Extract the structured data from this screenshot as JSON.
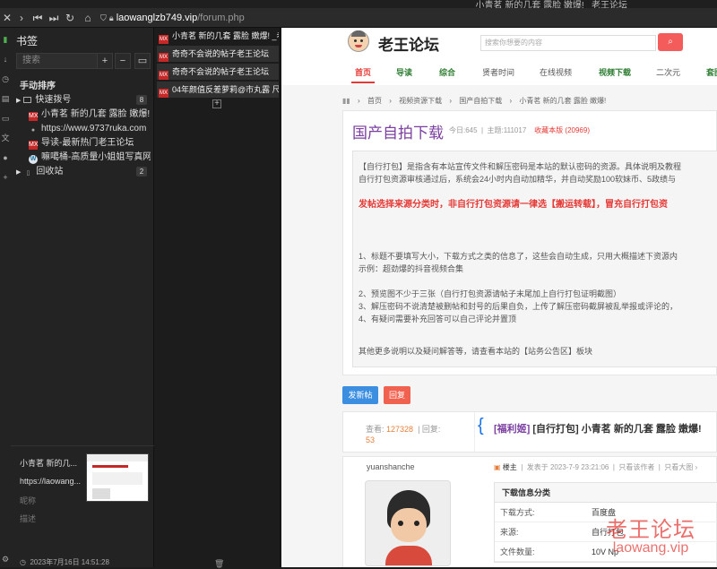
{
  "window": {
    "title": "小青茗 新的几套 露脸 嫩爆! _老王论坛"
  },
  "navbar": {
    "domain": "laowanglzb749.vip",
    "path": "/forum.php"
  },
  "bookmarks": {
    "heading": "书签",
    "search_placeholder": "搜索",
    "add_label": "+",
    "remove_label": "−",
    "sort_label": "手动排序",
    "items": [
      {
        "label": "快速拨号",
        "count": "8",
        "icon": "folder-icon"
      },
      {
        "label": "小青茗 新的几套 露脸 嫩爆! ...",
        "icon": "mx-favicon"
      },
      {
        "label": "https://www.9737ruka.com",
        "icon": "globe-icon"
      },
      {
        "label": "导读-最新热门老王论坛",
        "icon": "mx-favicon"
      },
      {
        "label": "嘛噶桶-高质量小姐姐写真网",
        "icon": "wordpress-icon"
      },
      {
        "label": "回收站",
        "count": "2",
        "icon": "trash-folder-icon"
      }
    ],
    "footer": {
      "title": "小青茗 新的几...",
      "url": "https://laowang...",
      "nickname_label": "昵称",
      "description_label": "描述",
      "date": "2023年7月16日 14:51:28"
    }
  },
  "tabs": [
    {
      "label": "小青茗 新的几套 露脸 嫩爆! _老王",
      "active": false
    },
    {
      "label": "奇奇不会说的帖子老王论坛",
      "active": true
    },
    {
      "label": "奇奇不会说的帖子老王论坛",
      "active": true
    },
    {
      "label": "04年颜值反差萝莉@市丸露 尺度私",
      "active": true
    }
  ],
  "site": {
    "logo_text": "老王论坛",
    "search_placeholder": "搜索你想要的内容",
    "search_button_icon": "search-icon",
    "nav": [
      {
        "label": "首页",
        "color": "#e53935"
      },
      {
        "label": "导读",
        "color": "#2e7d32"
      },
      {
        "label": "综合",
        "color": "#2e7d32"
      },
      {
        "label": "贤者时间",
        "color": "#555555"
      },
      {
        "label": "在线视频",
        "color": "#555555"
      },
      {
        "label": "视频下载",
        "color": "#2e7d32"
      },
      {
        "label": "二次元",
        "color": "#555555"
      },
      {
        "label": "套图",
        "color": "#2e7d32"
      }
    ],
    "breadcrumb": [
      "首页",
      "视频资源下载",
      "国产自拍下载",
      "小青茗 新的几套 露脸 嫩爆!"
    ],
    "forum": {
      "title": "国产自拍下载",
      "today": "今日:645",
      "topics": "主题:111017",
      "fav_label": "收藏本版",
      "fav_count": "(20969)"
    },
    "rules": [
      "【自行打包】是指含有本站宣传文件和解压密码是本站的默认密码的资源。具体说明及教程",
      "自行打包资源审核通过后，系统会24小时内自动加精华，并自动奖励100软妹币、5政绩与",
      "发帖选择来源分类时，非自行打包资源请一律选【搬运转载】，冒充自行打包资",
      "1、标题不要填写大小，下载方式之类的信息了，这些会自动生成，只用大概描述下资源内",
      "示例：超劲爆的抖音视频合集",
      "2、预览图不少于三张（自行打包资源请帖子末尾加上自行打包证明截图）",
      "3、解压密码不说清楚被删帖和封号的后果自负，上传了解压密码截屏被乱举报或评论的，",
      "4、有疑问需要补充回答可以自己评论并置顶",
      "其他更多说明以及疑问解答等，请查看本站的【站务公告区】板块"
    ],
    "post_button": "发新帖",
    "reply_button": "回复",
    "thread": {
      "views_label": "查看:",
      "views": "127328",
      "replies_label": "回复:",
      "replies": "53",
      "tag": "[福利姬]",
      "title": "[自行打包] 小青茗 新的几套 露脸 嫩爆!"
    },
    "post": {
      "author": "yuanshanche",
      "op_label": "楼主",
      "posted": "发表于 2023-7-9 23:21:06",
      "only_author": "只看该作者",
      "big_image": "只看大图",
      "download_title": "下载信息分类",
      "download_rows": [
        {
          "key": "下载方式:",
          "value": "百度盘"
        },
        {
          "key": "来源:",
          "value": "自行打包"
        },
        {
          "key": "文件数量:",
          "value": "10V Np"
        }
      ]
    },
    "watermark": {
      "line1": "老王论坛",
      "line2": "laowang.vip"
    }
  }
}
